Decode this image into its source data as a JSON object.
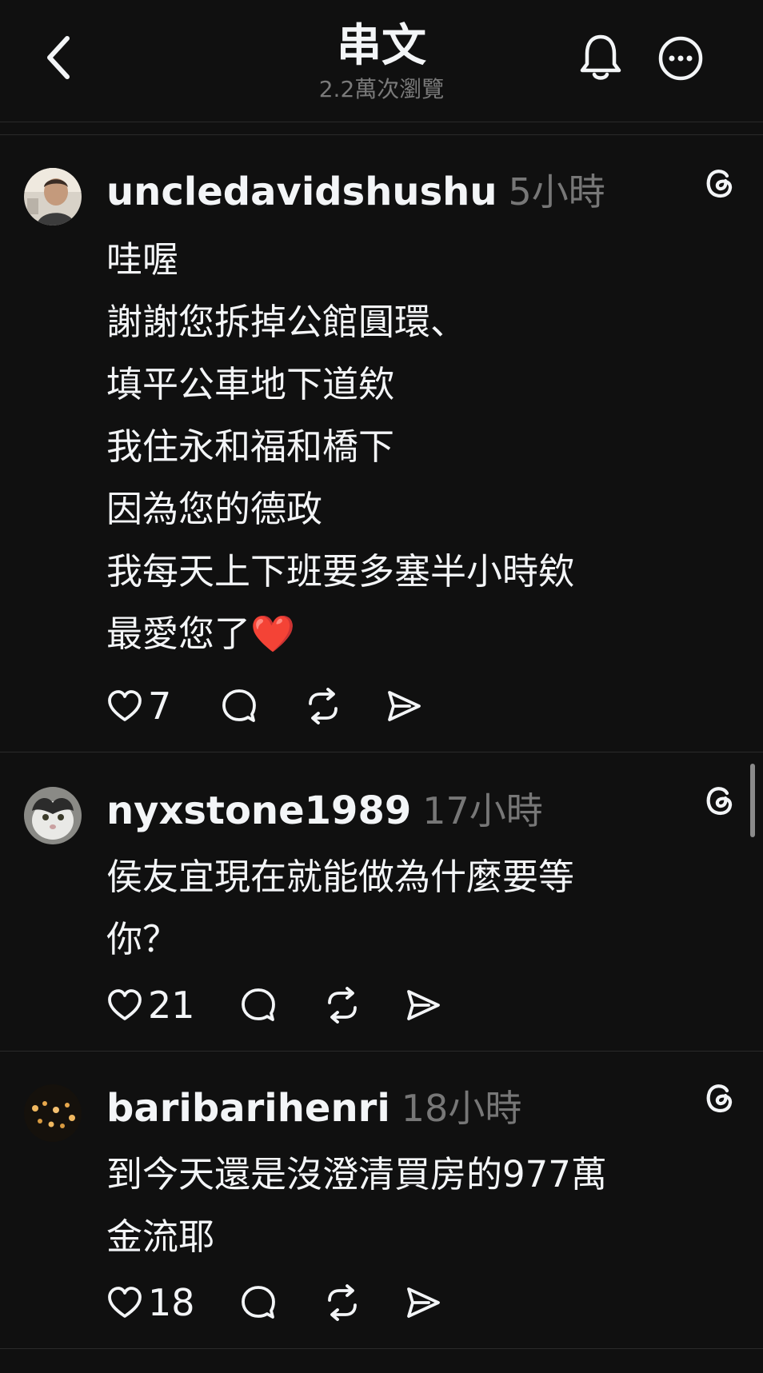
{
  "header": {
    "title": "串文",
    "subtitle": "2.2萬次瀏覽",
    "icons": [
      "chevron-left-icon",
      "bell-icon",
      "more-icon"
    ]
  },
  "posts": [
    {
      "username": "uncledavidshushu",
      "time": "5小時",
      "text": "哇喔\n謝謝您拆掉公館圓環、\n填平公車地下道欸\n我住永和福和橋下\n因為您的德政\n我每天上下班要多塞半小時欸\n最愛您了❤️",
      "likes": "7"
    },
    {
      "username": "nyxstone1989",
      "time": "17小時",
      "text": "侯友宜現在就能做為什麼要等\n你？",
      "likes": "21"
    },
    {
      "username": "baribarihenri",
      "time": "18小時",
      "text": "到今天還是沒澄清買房的977萬\n金流耶",
      "likes": "18"
    }
  ],
  "colors": {
    "background": "#101010",
    "text": "#f3f5f7",
    "muted": "#777777",
    "heart": "#e5312f"
  }
}
